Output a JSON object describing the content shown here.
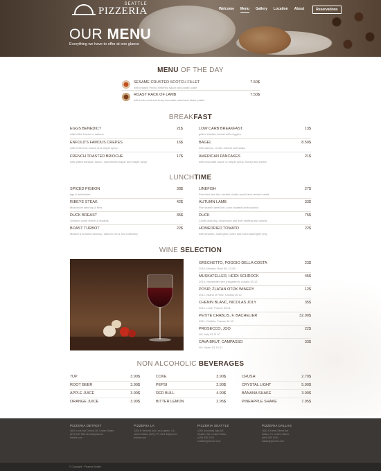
{
  "header": {
    "logo_sub": "SEATTLE",
    "logo_main": "PIZZERIA",
    "nav": [
      "Welcome",
      "Menu",
      "Gallery",
      "Location",
      "About"
    ],
    "nav_button": "Reservations",
    "title_thin": "OUR ",
    "title_bold": "MENU",
    "subtitle": "Everything we have to offer at one glance"
  },
  "menu_of_day": {
    "title_bold": "MENU",
    "title_thin": " OF THE DAY",
    "items": [
      {
        "name": "SESAME CRUSTED SCOTCH FILLET",
        "desc": "with braised Pedro Ximenez sauce and potato cake",
        "price": "7.50$"
      },
      {
        "name": "ROAST RACK OF LAMB",
        "desc": "with herb crust and fruity mountain salad and straw potato",
        "price": "7.50$"
      }
    ]
  },
  "breakfast": {
    "title_thin": "BREAK",
    "title_bold": "FAST",
    "left": [
      {
        "name": "EGGS BENEDICT",
        "desc": "with toffee bacon or salmon",
        "price": "21$"
      },
      {
        "name": "ENFOLD'S FAMOUS CREPES",
        "desc": "with fresh fruit, bacon and maple syrup",
        "price": "16$"
      },
      {
        "name": "FRENCH TOASTED BRIOCHE",
        "desc": "with grilled banana, bacon, cranberries maple and maple syrup",
        "price": "17$"
      }
    ],
    "right": [
      {
        "name": "LOW CARB BREAKFAST",
        "desc": "grilled chicken breast with veggies",
        "price": "13$"
      },
      {
        "name": "BAGEL",
        "desc": "with salmon, cream cheese and salsa",
        "price": "8.50$"
      },
      {
        "name": "AMERICAN PANCAKES",
        "desc": "with chocolate sauce or maple syrup, honey and cream",
        "price": "21$"
      }
    ]
  },
  "lunch": {
    "title_thin": "LUNCH",
    "title_bold": "TIME",
    "left": [
      {
        "name": "SPICED PIGEON",
        "desc": "figs & artichokes",
        "price": "38$"
      },
      {
        "name": "RIBEYE STEAK",
        "desc": "Mushroom ketchup & fries",
        "price": "42$"
      },
      {
        "name": "DUCK BREAST",
        "desc": "Smoked confit fennel & shallots",
        "price": "35$"
      },
      {
        "name": "BOAST TURBOT",
        "desc": "Mussel & smoked ketchup, salmon roe & sea rosemary",
        "price": "22$"
      }
    ],
    "right": [
      {
        "name": "LINEFISH",
        "desc": "Pan fried line fish, herbed ricotta ravioli and mussel salad",
        "price": "27$"
      },
      {
        "name": "AUTUMN LAMB",
        "desc": "Pan seared lamb loin, slow roasted lamb shanks",
        "price": "33$"
      },
      {
        "name": "DUCK",
        "desc": "Confit duck leg, mushroom and liver stuffing and onions",
        "price": "75$"
      },
      {
        "name": "HOMEDRIED TOMATO",
        "desc": "with sesame, aubergine puree and burnt aubergine jelly",
        "price": "22$"
      }
    ]
  },
  "wine": {
    "title_thin": "WINE ",
    "title_bold": "SELECTION",
    "items": [
      {
        "name": "GRECHETTO, POGGIO DELLA COSTA",
        "desc": "2015, Mabela, Ruto 38, 13.99",
        "price": "23$"
      },
      {
        "name": "MUSKATELLER, HEIDI SCHROCK",
        "desc": "2015, Neusiedler see (Hugarteni), Austria 30.12",
        "price": "45$"
      },
      {
        "name": "POSIP, ZLATAN OTOK WINERY",
        "desc": "2012, Island of Hvar, Croatia 30.12",
        "price": "12$"
      },
      {
        "name": "CHENIN BLANC, NICOLAS JOLY",
        "desc": "2012, Loire, France 30.01",
        "price": "35$"
      },
      {
        "name": "PETITE CHABLIS, F. BACHELIER",
        "desc": "2011, Chablis, France 02.49",
        "price": "32.90$"
      },
      {
        "name": "PROSECCO, JOO",
        "desc": "NV, Italy 03.11.97",
        "price": "22$"
      },
      {
        "name": "CAVA BRUT, CAMPASSO",
        "desc": "NV, Spain 03.13.91",
        "price": "33$"
      }
    ]
  },
  "beverages": {
    "title_thin": "NON ALCOHOLIC ",
    "title_bold": "BEVERAGES",
    "columns": [
      [
        {
          "name": "7UP",
          "price": "3.90$"
        },
        {
          "name": "ROOT BEER",
          "price": "3.90$"
        },
        {
          "name": "APPLE JUICE",
          "price": "3.90$"
        },
        {
          "name": "ORANGE JUICE",
          "price": "3.90$"
        }
      ],
      [
        {
          "name": "COKE",
          "price": "3.90$"
        },
        {
          "name": "PEPSI",
          "price": "2.90$"
        },
        {
          "name": "RED BULL",
          "price": "4.90$"
        },
        {
          "name": "BITTER LEMON",
          "price": "2.95$"
        }
      ],
      [
        {
          "name": "CRUSH",
          "price": "2.70$"
        },
        {
          "name": "CRYSTAL LIGHT",
          "price": "5.90$"
        },
        {
          "name": "BANANA SHAKE",
          "price": "3.90$"
        },
        {
          "name": "PINEAPPLE SHAKE",
          "price": "7.95$"
        }
      ]
    ]
  },
  "footer": {
    "columns": [
      {
        "heading": "PIZZERIA DETROIT",
        "lines": [
          "4600 Lone Ave Detroit, MI, United States",
          "(313) 000 555 detroit@pizzeria",
          "fetbets.com"
        ]
      },
      {
        "heading": "PIZZERIA LA",
        "lines": [
          "2250 N Vermont Ave Los Angeles, CA,",
          "United States (323) 774 4321 la@pizzeri",
          "fetbets.com"
        ]
      },
      {
        "heading": "PIZZERIA SEATTLE",
        "lines": [
          "4250 University Way NE",
          "Seattle, WA, United States",
          "(425) 555 3333",
          "seattle@pizzeria.com"
        ]
      },
      {
        "heading": "PIZZERIA DALLAS",
        "lines": [
          "1652 S Harris Street Ave",
          "Dallas, TX, United States",
          "(469) 555 0000",
          "dallas@pizzeria.com"
        ]
      }
    ],
    "copyright": "© Copyright · Pizzeria Seattle"
  }
}
